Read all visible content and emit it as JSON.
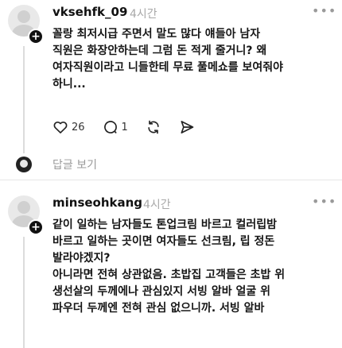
{
  "post1": {
    "username": "vksehfk_09",
    "time": "4시간",
    "text": "꼴랑 최저시급 주면서 말도 많다 얘들아 남자\n직원은 화장안하는데 그럼 돈 적게 줄거니? 왜\n여자직원이라고 니들한테 무료 풀메쇼를 보여줘야\n하니...",
    "likes": "26",
    "comments": "1",
    "reply_link": "답글 보기"
  },
  "post2": {
    "username": "minseohkang",
    "time": "4시간",
    "text": "같이 일하는 남자들도 톤업크림 바르고 컬러립밤\n바르고 일하는 곳이면 여자들도 선크림, 립 정돈\n발라야겠지?\n아니라면 전혀 상관없음. 초밥집 고객들은 초밥 위\n생선살의 두께에나 관심있지 서빙 알바 얼굴 위\n파우더 두께엔 전혀 관심 없으니까. 서빙 알바"
  },
  "icons": {
    "more": "more-dots-icon",
    "like": "heart-icon",
    "comment": "comment-icon",
    "repost": "repost-icon",
    "share": "send-icon",
    "follow": "plus-icon"
  },
  "colors": {
    "text": "#151515",
    "muted": "#a8a8a8",
    "badge": "#111111"
  }
}
